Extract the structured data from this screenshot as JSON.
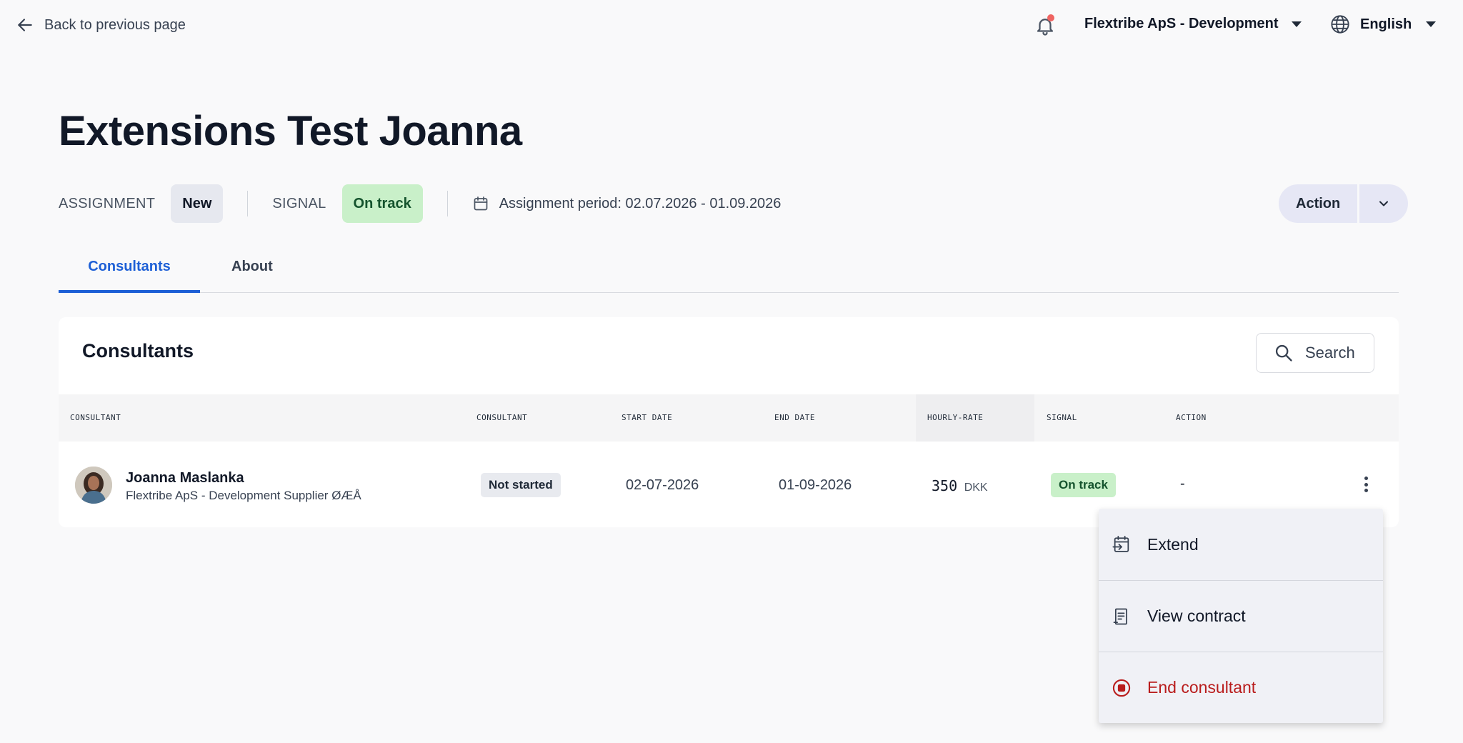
{
  "topbar": {
    "back_label": "Back to previous page",
    "organization": "Flextribe ApS - Development",
    "language": "English"
  },
  "page": {
    "title": "Extensions Test Joanna",
    "assignment_label": "ASSIGNMENT",
    "assignment_status": "New",
    "signal_label": "SIGNAL",
    "signal_status": "On track",
    "period": "Assignment period: 02.07.2026 - 01.09.2026",
    "action_label": "Action"
  },
  "tabs": [
    {
      "label": "Consultants",
      "active": true
    },
    {
      "label": "About",
      "active": false
    }
  ],
  "consultants_card": {
    "title": "Consultants",
    "search_label": "Search",
    "columns": [
      "CONSULTANT",
      "CONSULTANT",
      "START DATE",
      "END DATE",
      "HOURLY-RATE",
      "SIGNAL",
      "ACTION"
    ],
    "rows": [
      {
        "name": "Joanna Maslanka",
        "company": "Flextribe ApS - Development Supplier ØÆÅ",
        "status": "Not started",
        "start_date": "02-07-2026",
        "end_date": "01-09-2026",
        "rate": "350",
        "currency": "DKK",
        "signal": "On track",
        "action": "-"
      }
    ]
  },
  "row_menu": {
    "items": [
      {
        "label": "Extend",
        "icon": "calendar-extend-icon"
      },
      {
        "label": "View contract",
        "icon": "contract-icon"
      },
      {
        "label": "End consultant",
        "icon": "stop-circle-icon"
      }
    ]
  },
  "colors": {
    "accent": "#1d5fd6",
    "success_bg": "#c9f0c9",
    "danger": "#b91c1c",
    "notification_dot": "#ef6461"
  }
}
